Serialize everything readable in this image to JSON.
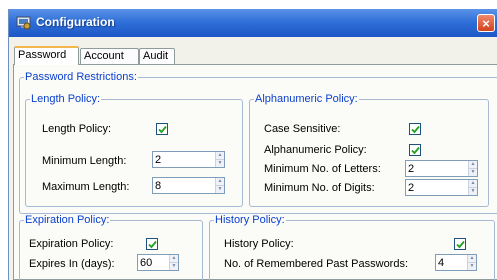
{
  "window": {
    "title": "Configuration",
    "close_label": "×"
  },
  "tabs": [
    "Password",
    "Account",
    "Audit"
  ],
  "password_restrictions": {
    "legend": "Password Restrictions:",
    "length_policy": {
      "legend": "Length Policy:",
      "enabled_label": "Length Policy:",
      "enabled": true,
      "min_label": "Minimum Length:",
      "min_value": "2",
      "max_label": "Maximum Length:",
      "max_value": "8"
    },
    "alphanumeric_policy": {
      "legend": "Alphanumeric Policy:",
      "case_label": "Case Sensitive:",
      "case_checked": true,
      "alnum_label": "Alphanumeric Policy:",
      "alnum_checked": true,
      "min_letters_label": "Minimum No. of Letters:",
      "min_letters_value": "2",
      "min_digits_label": "Minimum No. of Digits:",
      "min_digits_value": "2"
    }
  },
  "expiration_policy": {
    "legend": "Expiration Policy:",
    "enabled_label": "Expiration Policy:",
    "enabled": true,
    "expires_label": "Expires In (days):",
    "expires_value": "60"
  },
  "history_policy": {
    "legend": "History Policy:",
    "enabled_label": "History Policy:",
    "enabled": true,
    "remembered_label": "No. of Remembered Past Passwords:",
    "remembered_value": "4"
  }
}
